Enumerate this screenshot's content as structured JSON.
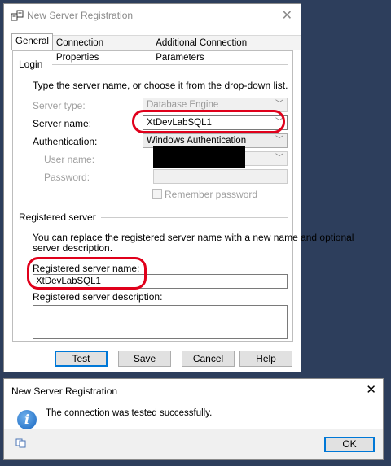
{
  "dialog": {
    "title": "New Server Registration",
    "close": "✕",
    "tabs": [
      "General",
      "Connection Properties",
      "Additional Connection Parameters"
    ],
    "login": {
      "section": "Login",
      "instruction": "Type the server name, or choose it from the drop-down list.",
      "server_type_label": "Server type:",
      "server_type_value": "Database Engine",
      "server_name_label": "Server name:",
      "server_name_value": "XtDevLabSQL1",
      "auth_label": "Authentication:",
      "auth_value": "Windows Authentication",
      "user_name_label": "User name:",
      "password_label": "Password:",
      "remember_label": "Remember password"
    },
    "registered": {
      "section": "Registered server",
      "instruction_line1": "You can replace the registered server name with a new name and optional",
      "instruction_line2": "server description.",
      "name_label": "Registered server name:",
      "name_value": "XtDevLabSQL1",
      "desc_label": "Registered server description:",
      "desc_value": ""
    },
    "buttons": {
      "test": "Test",
      "save": "Save",
      "cancel": "Cancel",
      "help": "Help"
    }
  },
  "message_box": {
    "title": "New Server Registration",
    "close": "✕",
    "icon": "info-icon",
    "text": "The connection was tested successfully.",
    "ok": "OK"
  },
  "colors": {
    "highlight": "#e0001b",
    "background": "#2d3e5c",
    "default_button_border": "#0078d7"
  }
}
